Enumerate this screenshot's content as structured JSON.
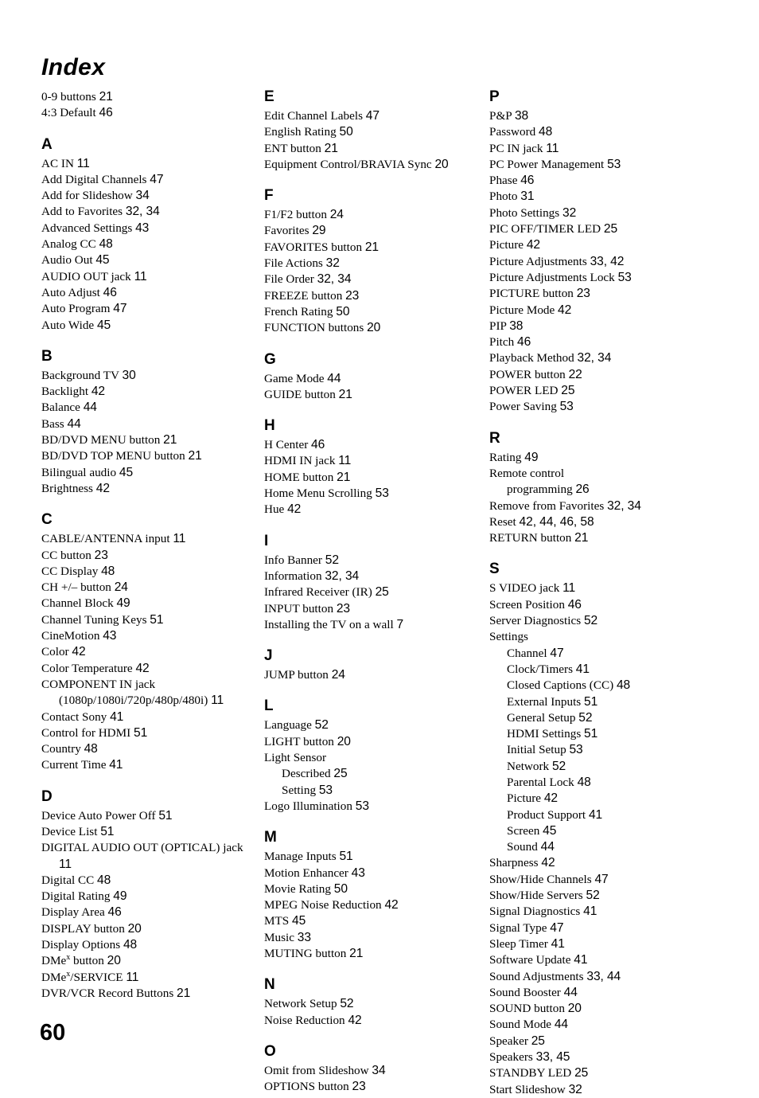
{
  "document": {
    "title": "Index",
    "folio": "60"
  },
  "columns": [
    {
      "name": "left",
      "preamble": [
        {
          "label": "0-9 buttons",
          "pages": "21"
        },
        {
          "label": "4:3 Default",
          "pages": "46"
        }
      ],
      "sections": [
        {
          "letter": "A",
          "entries": [
            {
              "label": "AC IN",
              "pages": "11"
            },
            {
              "label": "Add Digital Channels",
              "pages": "47"
            },
            {
              "label": "Add for Slideshow",
              "pages": "34"
            },
            {
              "label": "Add to Favorites",
              "pages": "32, 34"
            },
            {
              "label": "Advanced Settings",
              "pages": "43"
            },
            {
              "label": "Analog CC",
              "pages": "48"
            },
            {
              "label": "Audio Out",
              "pages": "45"
            },
            {
              "label": "AUDIO OUT jack",
              "pages": "11"
            },
            {
              "label": "Auto Adjust",
              "pages": "46"
            },
            {
              "label": "Auto Program",
              "pages": "47"
            },
            {
              "label": "Auto Wide",
              "pages": "45"
            }
          ]
        },
        {
          "letter": "B",
          "entries": [
            {
              "label": "Background TV",
              "pages": "30"
            },
            {
              "label": "Backlight",
              "pages": "42"
            },
            {
              "label": "Balance",
              "pages": "44"
            },
            {
              "label": "Bass",
              "pages": "44"
            },
            {
              "label": "BD/DVD MENU button",
              "pages": "21"
            },
            {
              "label": "BD/DVD TOP MENU button",
              "pages": "21"
            },
            {
              "label": "Bilingual audio",
              "pages": "45"
            },
            {
              "label": "Brightness",
              "pages": "42"
            }
          ]
        },
        {
          "letter": "C",
          "entries": [
            {
              "label": "CABLE/ANTENNA input",
              "pages": "11"
            },
            {
              "label": "CC button",
              "pages": "23"
            },
            {
              "label": "CC Display",
              "pages": "48"
            },
            {
              "label": "CH +/– button",
              "pages": "24"
            },
            {
              "label": "Channel Block",
              "pages": "49"
            },
            {
              "label": "Channel Tuning Keys",
              "pages": "51"
            },
            {
              "label": "CineMotion",
              "pages": "43"
            },
            {
              "label": "Color",
              "pages": "42"
            },
            {
              "label": "Color Temperature",
              "pages": "42"
            },
            {
              "label": "COMPONENT IN jack (1080p/1080i/720p/480p/480i)",
              "pages": "11"
            },
            {
              "label": "Contact Sony",
              "pages": "41"
            },
            {
              "label": "Control for HDMI",
              "pages": "51"
            },
            {
              "label": "Country",
              "pages": "48"
            },
            {
              "label": "Current Time",
              "pages": "41"
            }
          ]
        },
        {
          "letter": "D",
          "entries": [
            {
              "label": "Device Auto Power Off",
              "pages": "51"
            },
            {
              "label": "Device List",
              "pages": "51"
            },
            {
              "label": "DIGITAL AUDIO OUT (OPTICAL) jack",
              "pages": "11"
            },
            {
              "label": "Digital CC",
              "pages": "48"
            },
            {
              "label": "Digital Rating",
              "pages": "49"
            },
            {
              "label": "Display Area",
              "pages": "46"
            },
            {
              "label": "DISPLAY button",
              "pages": "20"
            },
            {
              "label": "Display Options",
              "pages": "48"
            },
            {
              "label": "DMe",
              "sup": "x",
              "label_after": " button",
              "pages": "20"
            },
            {
              "label": "DMe",
              "sup": "x",
              "label_after": "/SERVICE",
              "pages": "11"
            },
            {
              "label": "DVR/VCR Record Buttons",
              "pages": "21"
            }
          ]
        }
      ]
    },
    {
      "name": "middle",
      "preamble": [],
      "sections": [
        {
          "letter": "E",
          "entries": [
            {
              "label": "Edit Channel Labels",
              "pages": "47"
            },
            {
              "label": "English Rating",
              "pages": "50"
            },
            {
              "label": "ENT button",
              "pages": "21"
            },
            {
              "label": "Equipment Control/BRAVIA Sync",
              "pages": "20"
            }
          ]
        },
        {
          "letter": "F",
          "entries": [
            {
              "label": "F1/F2 button",
              "pages": "24"
            },
            {
              "label": "Favorites",
              "pages": "29"
            },
            {
              "label": "FAVORITES button",
              "pages": "21"
            },
            {
              "label": "File Actions",
              "pages": "32"
            },
            {
              "label": "File Order",
              "pages": "32, 34"
            },
            {
              "label": "FREEZE button",
              "pages": "23"
            },
            {
              "label": "French Rating",
              "pages": "50"
            },
            {
              "label": "FUNCTION buttons",
              "pages": "20"
            }
          ]
        },
        {
          "letter": "G",
          "entries": [
            {
              "label": "Game Mode",
              "pages": "44"
            },
            {
              "label": "GUIDE button",
              "pages": "21"
            }
          ]
        },
        {
          "letter": "H",
          "entries": [
            {
              "label": "H Center",
              "pages": "46"
            },
            {
              "label": "HDMI IN jack",
              "pages": "11"
            },
            {
              "label": "HOME button",
              "pages": "21"
            },
            {
              "label": "Home Menu Scrolling",
              "pages": "53"
            },
            {
              "label": "Hue",
              "pages": "42"
            }
          ]
        },
        {
          "letter": "I",
          "entries": [
            {
              "label": "Info Banner",
              "pages": "52"
            },
            {
              "label": "Information",
              "pages": "32, 34"
            },
            {
              "label": "Infrared Receiver (IR)",
              "pages": "25"
            },
            {
              "label": "INPUT button",
              "pages": "23"
            },
            {
              "label": "Installing the TV on a wall",
              "pages": "7"
            }
          ]
        },
        {
          "letter": "J",
          "entries": [
            {
              "label": "JUMP button",
              "pages": "24"
            }
          ]
        },
        {
          "letter": "L",
          "entries": [
            {
              "label": "Language",
              "pages": "52"
            },
            {
              "label": "LIGHT button",
              "pages": "20"
            },
            {
              "label": "Light Sensor",
              "pages": ""
            },
            {
              "label": "Described",
              "pages": "25",
              "sub": true
            },
            {
              "label": "Setting",
              "pages": "53",
              "sub": true
            },
            {
              "label": "Logo Illumination",
              "pages": "53"
            }
          ]
        },
        {
          "letter": "M",
          "entries": [
            {
              "label": "Manage Inputs",
              "pages": "51"
            },
            {
              "label": "Motion Enhancer",
              "pages": "43"
            },
            {
              "label": "Movie Rating",
              "pages": "50"
            },
            {
              "label": "MPEG Noise Reduction",
              "pages": "42"
            },
            {
              "label": "MTS",
              "pages": "45"
            },
            {
              "label": "Music",
              "pages": "33"
            },
            {
              "label": "MUTING button",
              "pages": "21"
            }
          ]
        },
        {
          "letter": "N",
          "entries": [
            {
              "label": "Network Setup",
              "pages": "52"
            },
            {
              "label": "Noise Reduction",
              "pages": "42"
            }
          ]
        },
        {
          "letter": "O",
          "entries": [
            {
              "label": "Omit from Slideshow",
              "pages": "34"
            },
            {
              "label": "OPTIONS button",
              "pages": "23"
            }
          ]
        }
      ]
    },
    {
      "name": "right",
      "preamble": [],
      "sections": [
        {
          "letter": "P",
          "entries": [
            {
              "label": "P&P",
              "pages": "38"
            },
            {
              "label": "Password",
              "pages": "48"
            },
            {
              "label": "PC IN jack",
              "pages": "11"
            },
            {
              "label": "PC Power Management",
              "pages": "53"
            },
            {
              "label": "Phase",
              "pages": "46"
            },
            {
              "label": "Photo",
              "pages": "31"
            },
            {
              "label": "Photo Settings",
              "pages": "32"
            },
            {
              "label": "PIC OFF/TIMER LED",
              "pages": "25"
            },
            {
              "label": "Picture",
              "pages": "42"
            },
            {
              "label": "Picture Adjustments",
              "pages": "33, 42"
            },
            {
              "label": "Picture Adjustments Lock",
              "pages": "53"
            },
            {
              "label": "PICTURE button",
              "pages": "23"
            },
            {
              "label": "Picture Mode",
              "pages": "42"
            },
            {
              "label": "PIP",
              "pages": "38"
            },
            {
              "label": "Pitch",
              "pages": "46"
            },
            {
              "label": "Playback Method",
              "pages": "32, 34"
            },
            {
              "label": "POWER button",
              "pages": "22"
            },
            {
              "label": "POWER LED",
              "pages": "25"
            },
            {
              "label": "Power Saving",
              "pages": "53"
            }
          ]
        },
        {
          "letter": "R",
          "entries": [
            {
              "label": "Rating",
              "pages": "49"
            },
            {
              "label": "Remote control",
              "pages": ""
            },
            {
              "label": "programming",
              "pages": "26",
              "sub": true
            },
            {
              "label": "Remove from Favorites",
              "pages": "32, 34"
            },
            {
              "label": "Reset",
              "pages": "42, 44, 46, 58"
            },
            {
              "label": "RETURN button",
              "pages": "21"
            }
          ]
        },
        {
          "letter": "S",
          "entries": [
            {
              "label": "S VIDEO jack",
              "pages": "11"
            },
            {
              "label": "Screen Position",
              "pages": "46"
            },
            {
              "label": "Server Diagnostics",
              "pages": "52"
            },
            {
              "label": "Settings",
              "pages": ""
            },
            {
              "label": "Channel",
              "pages": "47",
              "sub": true
            },
            {
              "label": "Clock/Timers",
              "pages": "41",
              "sub": true
            },
            {
              "label": "Closed Captions (CC)",
              "pages": "48",
              "sub": true
            },
            {
              "label": "External Inputs",
              "pages": "51",
              "sub": true
            },
            {
              "label": "General Setup",
              "pages": "52",
              "sub": true
            },
            {
              "label": "HDMI Settings",
              "pages": "51",
              "sub": true
            },
            {
              "label": "Initial Setup",
              "pages": "53",
              "sub": true
            },
            {
              "label": "Network",
              "pages": "52",
              "sub": true
            },
            {
              "label": "Parental Lock",
              "pages": "48",
              "sub": true
            },
            {
              "label": "Picture",
              "pages": "42",
              "sub": true
            },
            {
              "label": "Product Support",
              "pages": "41",
              "sub": true
            },
            {
              "label": "Screen",
              "pages": "45",
              "sub": true
            },
            {
              "label": "Sound",
              "pages": "44",
              "sub": true
            },
            {
              "label": "Sharpness",
              "pages": "42"
            },
            {
              "label": "Show/Hide Channels",
              "pages": "47"
            },
            {
              "label": "Show/Hide Servers",
              "pages": "52"
            },
            {
              "label": "Signal Diagnostics",
              "pages": "41"
            },
            {
              "label": "Signal Type",
              "pages": "47"
            },
            {
              "label": "Sleep Timer",
              "pages": "41"
            },
            {
              "label": "Software Update",
              "pages": "41"
            },
            {
              "label": "Sound Adjustments",
              "pages": "33, 44"
            },
            {
              "label": "Sound Booster",
              "pages": "44"
            },
            {
              "label": "SOUND button",
              "pages": "20"
            },
            {
              "label": "Sound Mode",
              "pages": "44"
            },
            {
              "label": "Speaker",
              "pages": "25"
            },
            {
              "label": "Speakers",
              "pages": "33, 45"
            },
            {
              "label": "STANDBY LED",
              "pages": "25"
            },
            {
              "label": "Start Slideshow",
              "pages": "32"
            }
          ]
        }
      ]
    }
  ]
}
